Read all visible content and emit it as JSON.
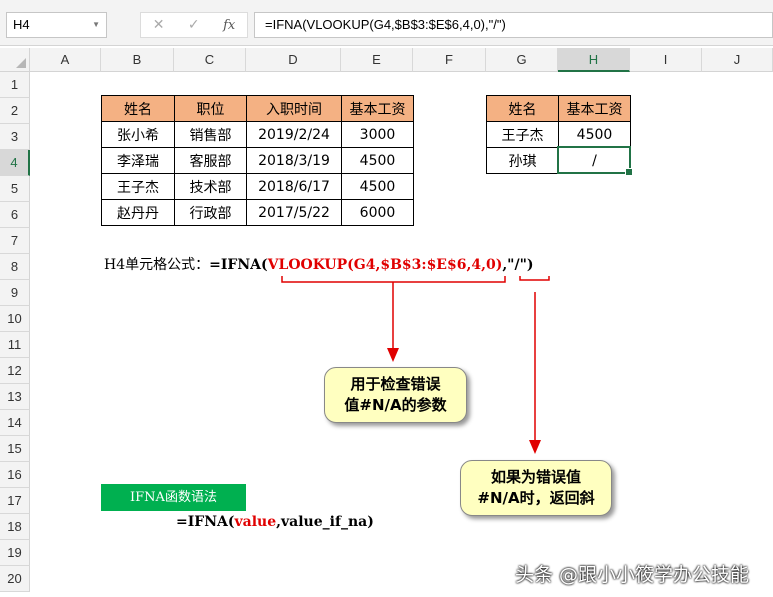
{
  "formula_bar": {
    "name_box": "H4",
    "cancel_icon": "✕",
    "enter_icon": "✓",
    "fx_label": "fx",
    "formula": "=IFNA(VLOOKUP(G4,$B$3:$E$6,4,0),\"/\")"
  },
  "columns": [
    "A",
    "B",
    "C",
    "D",
    "E",
    "F",
    "G",
    "H",
    "I",
    "J"
  ],
  "rows": [
    "1",
    "2",
    "3",
    "4",
    "5",
    "6",
    "7",
    "8",
    "9",
    "10",
    "11",
    "12",
    "13",
    "14",
    "15",
    "16",
    "17",
    "18",
    "19",
    "20"
  ],
  "table1": {
    "headers": [
      "姓名",
      "职位",
      "入职时间",
      "基本工资"
    ],
    "rows": [
      [
        "张小希",
        "销售部",
        "2019/2/24",
        "3000"
      ],
      [
        "李泽瑞",
        "客服部",
        "2018/3/19",
        "4500"
      ],
      [
        "王子杰",
        "技术部",
        "2018/6/17",
        "4500"
      ],
      [
        "赵丹丹",
        "行政部",
        "2017/5/22",
        "6000"
      ]
    ]
  },
  "table2": {
    "headers": [
      "姓名",
      "基本工资"
    ],
    "rows": [
      [
        "王子杰",
        "4500"
      ],
      [
        "孙琪",
        "/"
      ]
    ]
  },
  "formula_note": {
    "label": "H4单元格公式：",
    "prefix": "=IFNA(",
    "arg1": "VLOOKUP(G4,$B$3:$E$6,4,0)",
    "rest": ",\"/\")"
  },
  "callout1": {
    "line1": "用于检查错误",
    "line2": "值#N/A的参数"
  },
  "callout2": {
    "line1": "如果为错误值",
    "line2": "#N/A时，返回斜"
  },
  "syntax": {
    "title": "IFNA函数语法",
    "prefix": "=IFNA(",
    "arg1": "value",
    "rest": ",value_if_na)"
  },
  "watermark": "头条 @跟小小筱学办公技能"
}
